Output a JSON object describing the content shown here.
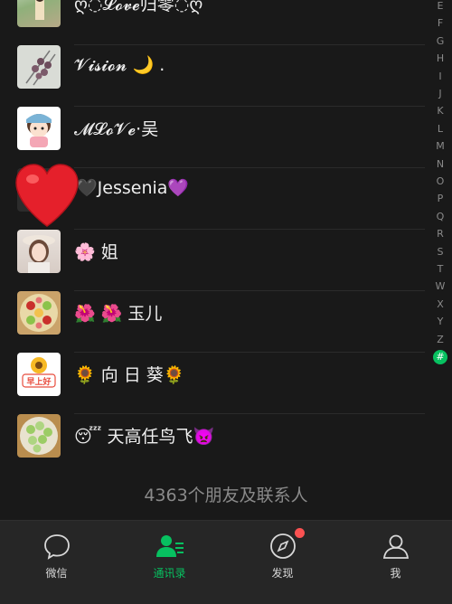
{
  "contacts": [
    {
      "name": "ღ◌︎𝓛𝓸𝓿𝓮归零◌︎ღ",
      "avatar": "avatar-photo-outdoor"
    },
    {
      "name": "𝓥𝓲𝓼𝓲𝓸𝓷 🌙 .",
      "avatar": "avatar-skewers"
    },
    {
      "name": "𝓜𝓛𝓸𝓥𝓮·吴",
      "avatar": "avatar-cartoon-girl"
    },
    {
      "name": "🖤Jessenia💜",
      "avatar": "avatar-dark"
    },
    {
      "name": "🌸 姐",
      "avatar": "avatar-woman-hat"
    },
    {
      "name": "🌺 🌺 玉儿",
      "avatar": "avatar-fruit-plate"
    },
    {
      "name": "🌻  向 日 葵🌻",
      "avatar": "avatar-sunflower-greeting"
    },
    {
      "name": "😴 天高任鸟飞👿",
      "avatar": "avatar-dumplings"
    }
  ],
  "sunflower_avatar_text": "早上好",
  "index_letters": [
    "E",
    "F",
    "G",
    "H",
    "I",
    "J",
    "K",
    "L",
    "M",
    "N",
    "O",
    "P",
    "Q",
    "R",
    "S",
    "T",
    "W",
    "X",
    "Y",
    "Z",
    "#"
  ],
  "contact_count": "4363个朋友及联系人",
  "tabs": [
    {
      "label": "微信",
      "icon": "chat-bubble-icon"
    },
    {
      "label": "通讯录",
      "icon": "contacts-icon"
    },
    {
      "label": "发现",
      "icon": "compass-icon"
    },
    {
      "label": "我",
      "icon": "profile-icon"
    }
  ],
  "colors": {
    "accent": "#07c160",
    "badge": "#fa5151",
    "background": "#191919"
  }
}
